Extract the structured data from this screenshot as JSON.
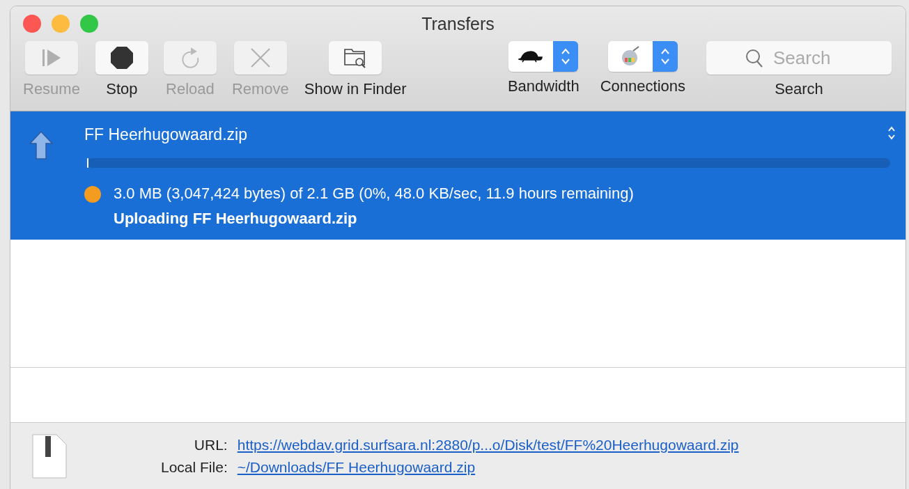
{
  "window": {
    "title": "Transfers"
  },
  "toolbar": {
    "buttons": [
      {
        "kind": "resume",
        "label": "Resume",
        "disabled": true
      },
      {
        "kind": "stop",
        "label": "Stop",
        "disabled": false
      },
      {
        "kind": "reload",
        "label": "Reload",
        "disabled": true
      },
      {
        "kind": "remove",
        "label": "Remove",
        "disabled": true
      },
      {
        "kind": "finder",
        "label": "Show in Finder",
        "disabled": false
      }
    ],
    "popups": [
      {
        "kind": "bandwidth",
        "label": "Bandwidth"
      },
      {
        "kind": "connections",
        "label": "Connections"
      }
    ],
    "search": {
      "placeholder": "Search",
      "label": "Search"
    }
  },
  "transfers": [
    {
      "name": "FF Heerhugowaard.zip",
      "selected": true,
      "level": 0.0014,
      "color": "#f39c1f",
      "progress_text": "3.0 MB (3,047,424 bytes) of 2.1 GB (0%, 48.0 KB/sec, 11.9 hours remaining)",
      "status": "Uploading FF Heerhugowaard.zip"
    }
  ],
  "details": {
    "url_label": "URL:",
    "url": "https://webdav.grid.surfsara.nl:2880/p...o/Disk/test/FF%20Heerhugowaard.zip",
    "local_label": "Local File:",
    "local": "~/Downloads/FF Heerhugowaard.zip"
  }
}
